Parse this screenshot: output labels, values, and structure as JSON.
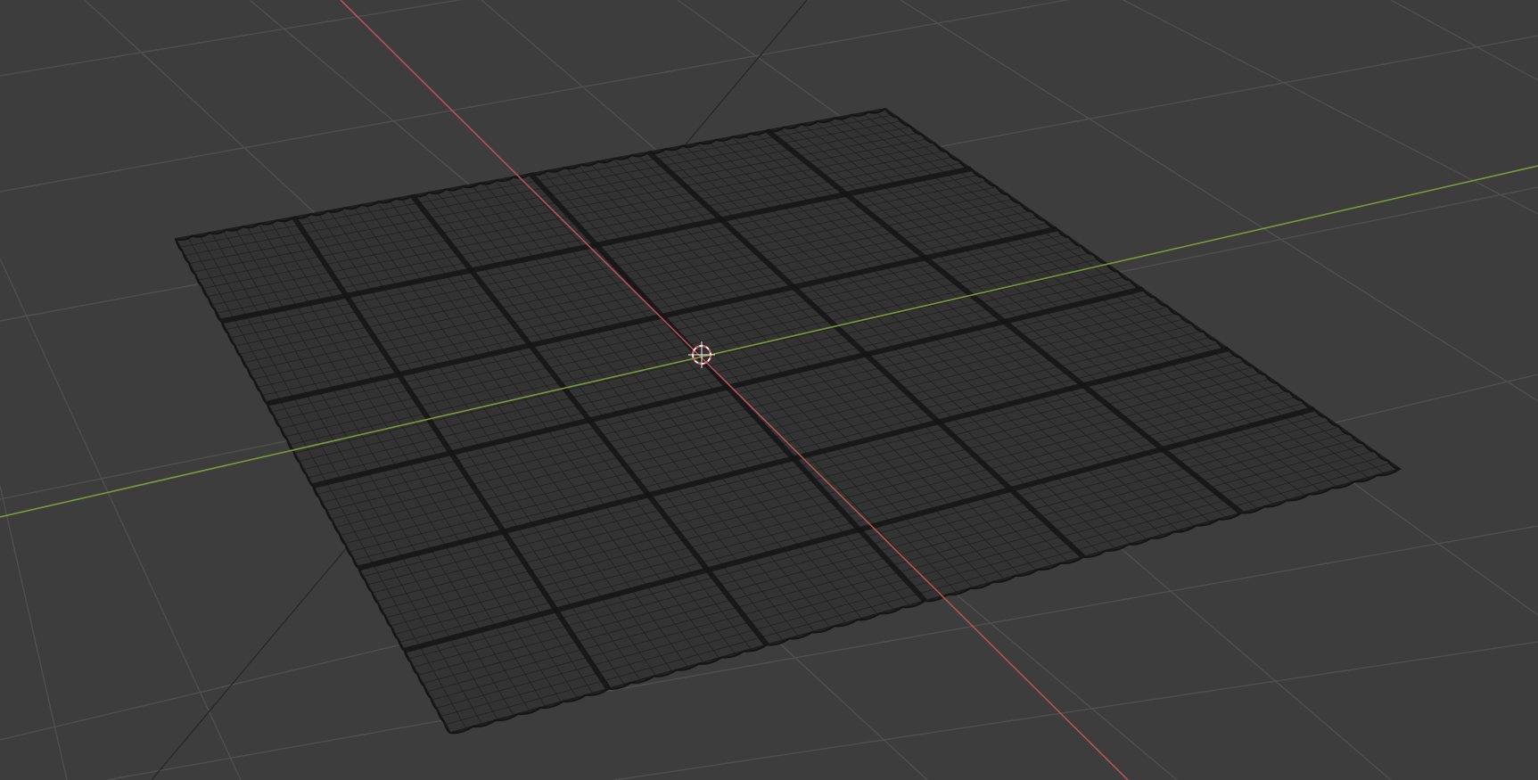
{
  "app": {
    "view": "3D Viewport",
    "shading": "wireframe"
  },
  "colors": {
    "background": "#3d3d3d",
    "floor_grid": "#4f4f4f",
    "x_axis": "#b5525a",
    "y_axis": "#7b9a3c",
    "mesh_dense": "#1e1e1e",
    "mesh_fill": "#333333",
    "mesh_seam": "#151515",
    "cursor_red": "#e25757",
    "cursor_white": "#f2f2f2"
  },
  "scene": {
    "object": {
      "type": "tiled-plane-mesh",
      "tiles_u": 6,
      "tiles_v": 6,
      "subdivisions_per_tile": 10,
      "edge_style": "scalloped"
    },
    "world_axes": [
      "x-axis",
      "y-axis"
    ],
    "origin_marker": "3d-cursor"
  }
}
